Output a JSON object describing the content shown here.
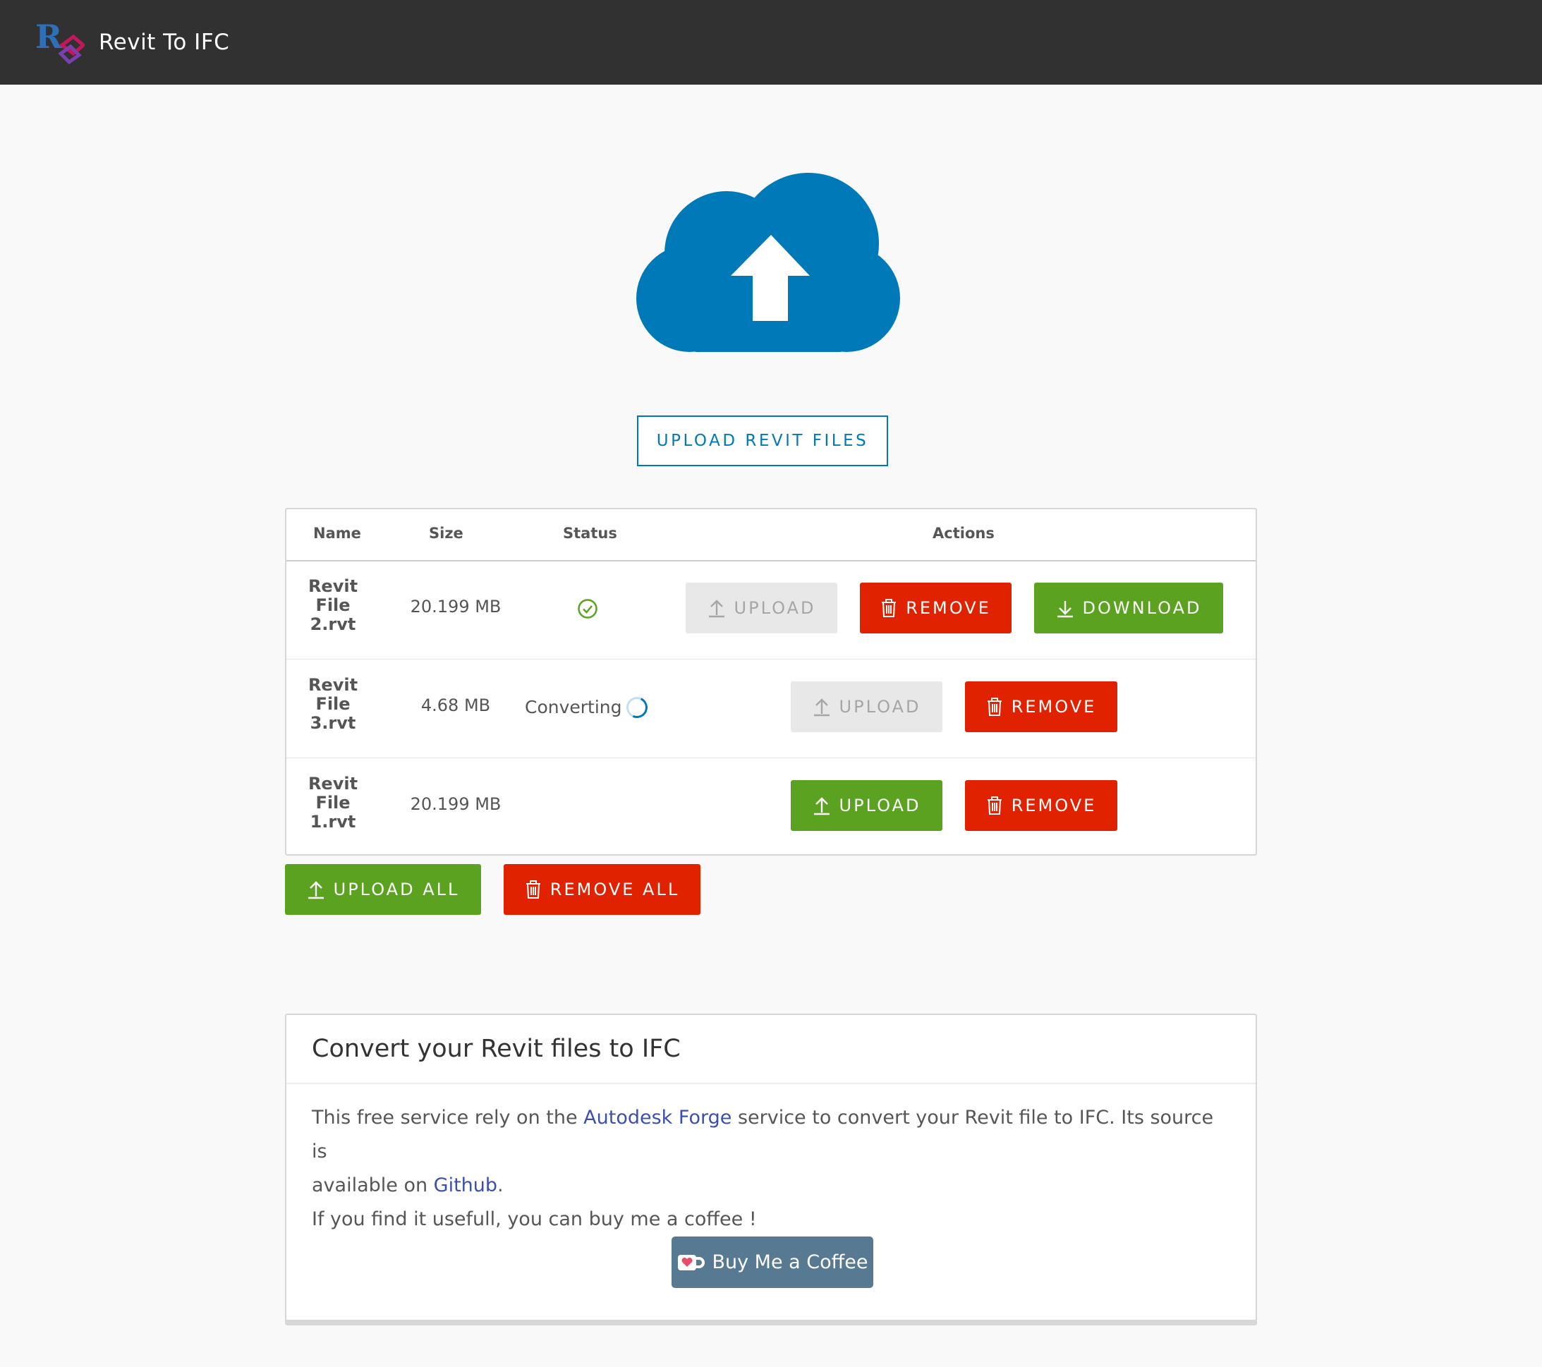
{
  "header": {
    "title": "Revit To IFC",
    "logo_text": "R"
  },
  "upload_button": {
    "label": "UPLOAD REVIT FILES"
  },
  "table": {
    "columns": [
      "Name",
      "Size",
      "Status",
      "Actions"
    ],
    "rows": [
      {
        "name": [
          "Revit",
          "File",
          "2.rvt"
        ],
        "size": "20.199 MB",
        "status": "done",
        "status_text": ""
      },
      {
        "name": [
          "Revit",
          "File",
          "3.rvt"
        ],
        "size": "4.68 MB",
        "status": "converting",
        "status_text": "Converting"
      },
      {
        "name": [
          "Revit",
          "File",
          "1.rvt"
        ],
        "size": "20.199 MB",
        "status": "",
        "status_text": ""
      }
    ],
    "labels": {
      "upload": "UPLOAD",
      "remove": "REMOVE",
      "download": "DOWNLOAD"
    }
  },
  "bulk": {
    "upload_all": "UPLOAD ALL",
    "remove_all": "REMOVE ALL"
  },
  "info": {
    "title": "Convert your Revit files to IFC",
    "p1_a": "This free service rely on the ",
    "p1_link": "Autodesk Forge",
    "p1_b": " service to convert your Revit file to IFC. Its source is",
    "p2_a": "available on ",
    "p2_link": "Github",
    "p2_b": ".",
    "p3": "If you find it usefull, you can buy me a coffee !",
    "coffee_button": "Buy Me a Coffee"
  },
  "colors": {
    "header_bg": "#313131",
    "primary": "#0079b8",
    "success": "#5aa220",
    "danger": "#e12200",
    "disabled": "#e8e8e8"
  },
  "icons": [
    "logo-icon",
    "cloud-upload-icon",
    "check-circle-icon",
    "spinner-icon",
    "upload-icon",
    "trash-icon",
    "download-icon",
    "coffee-cup-icon"
  ]
}
